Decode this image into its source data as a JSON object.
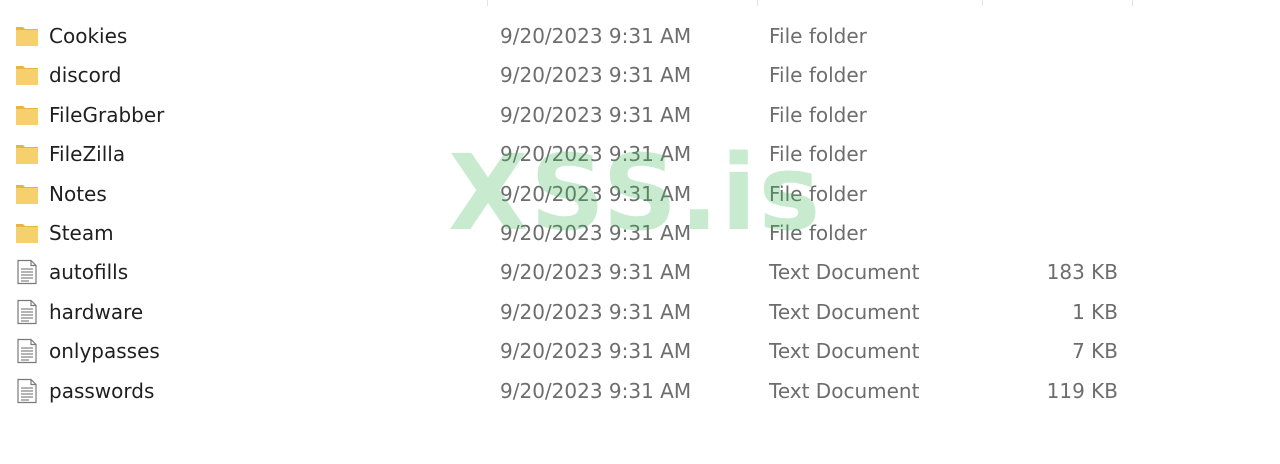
{
  "watermark": "XSS.is",
  "icons": {
    "folder": "folder-icon",
    "text_document": "text-document-icon"
  },
  "colors": {
    "folder_fill": "#f6d06c",
    "folder_dark": "#e7b541",
    "watermark": "#3cbb5a",
    "secondary_text": "#6d6d6d"
  },
  "files": [
    {
      "name": "Cookies",
      "date": "9/20/2023 9:31 AM",
      "type": "File folder",
      "size": "",
      "icon": "folder-icon"
    },
    {
      "name": "discord",
      "date": "9/20/2023 9:31 AM",
      "type": "File folder",
      "size": "",
      "icon": "folder-icon"
    },
    {
      "name": "FileGrabber",
      "date": "9/20/2023 9:31 AM",
      "type": "File folder",
      "size": "",
      "icon": "folder-icon"
    },
    {
      "name": "FileZilla",
      "date": "9/20/2023 9:31 AM",
      "type": "File folder",
      "size": "",
      "icon": "folder-icon"
    },
    {
      "name": "Notes",
      "date": "9/20/2023 9:31 AM",
      "type": "File folder",
      "size": "",
      "icon": "folder-icon"
    },
    {
      "name": "Steam",
      "date": "9/20/2023 9:31 AM",
      "type": "File folder",
      "size": "",
      "icon": "folder-icon"
    },
    {
      "name": "autofills",
      "date": "9/20/2023 9:31 AM",
      "type": "Text Document",
      "size": "183 KB",
      "icon": "text-document-icon"
    },
    {
      "name": "hardware",
      "date": "9/20/2023 9:31 AM",
      "type": "Text Document",
      "size": "1 KB",
      "icon": "text-document-icon"
    },
    {
      "name": "onlypasses",
      "date": "9/20/2023 9:31 AM",
      "type": "Text Document",
      "size": "7 KB",
      "icon": "text-document-icon"
    },
    {
      "name": "passwords",
      "date": "9/20/2023 9:31 AM",
      "type": "Text Document",
      "size": "119 KB",
      "icon": "text-document-icon"
    }
  ]
}
